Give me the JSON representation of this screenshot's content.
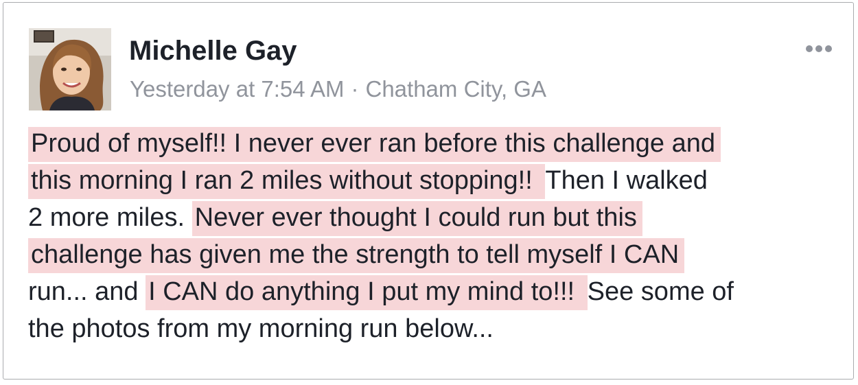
{
  "post": {
    "author": "Michelle Gay",
    "timestamp": "Yesterday at 7:54 AM",
    "separator": "·",
    "location": "Chatham City, GA",
    "more_icon": "more-horizontal-icon",
    "avatar_icon": "avatar-photo",
    "highlight_color": "#f7d6d8",
    "lines": [
      [
        {
          "text": "Proud of myself!!  I never ever ran before this challenge and",
          "hl": true
        }
      ],
      [
        {
          "text": "this morning I ran 2 miles without stopping!! ",
          "hl": true
        },
        {
          "text": " Then I walked",
          "hl": false
        }
      ],
      [
        {
          "text": "2 more miles.  ",
          "hl": false
        },
        {
          "text": "Never ever thought I could run but this",
          "hl": true
        }
      ],
      [
        {
          "text": "challenge has given me the strength to tell myself I CAN",
          "hl": true
        }
      ],
      [
        {
          "text": "run... and ",
          "hl": false
        },
        {
          "text": "I CAN do anything I put my mind to!!! ",
          "hl": true
        },
        {
          "text": " See some of",
          "hl": false
        }
      ],
      [
        {
          "text": "the photos from my morning run below...",
          "hl": false
        }
      ]
    ]
  }
}
